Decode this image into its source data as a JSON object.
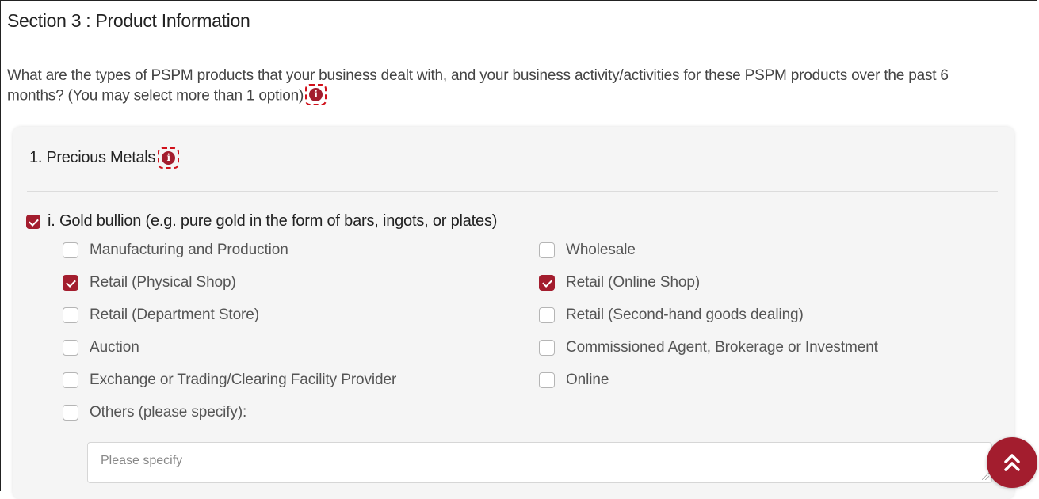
{
  "section": {
    "title": "Section 3 : Product Information",
    "question": "What are the types of PSPM products that your business dealt with, and your business activity/activities for these PSPM products over the past 6 months? (You may select more than 1 option)"
  },
  "category": {
    "title": "1. Precious Metals"
  },
  "product": {
    "label": "i. Gold bullion (e.g. pure gold in the form of bars, ingots, or plates)",
    "checked": true
  },
  "activities": {
    "left": [
      {
        "label": "Manufacturing and Production",
        "checked": false
      },
      {
        "label": "Retail (Physical Shop)",
        "checked": true
      },
      {
        "label": "Retail (Department Store)",
        "checked": false
      },
      {
        "label": "Auction",
        "checked": false
      },
      {
        "label": "Exchange or Trading/Clearing Facility Provider",
        "checked": false
      },
      {
        "label": "Others (please specify):",
        "checked": false
      }
    ],
    "right": [
      {
        "label": "Wholesale",
        "checked": false
      },
      {
        "label": "Retail (Online Shop)",
        "checked": true
      },
      {
        "label": "Retail (Second-hand goods dealing)",
        "checked": false
      },
      {
        "label": "Commissioned Agent, Brokerage or Investment",
        "checked": false
      },
      {
        "label": "Online",
        "checked": false
      }
    ]
  },
  "others_input": {
    "placeholder": "Please specify",
    "value": ""
  },
  "icons": {
    "info": "info-icon",
    "scroll_top": "double-chevron-up-icon"
  },
  "colors": {
    "accent": "#a31d2e",
    "highlight_dash": "#d0101a"
  }
}
